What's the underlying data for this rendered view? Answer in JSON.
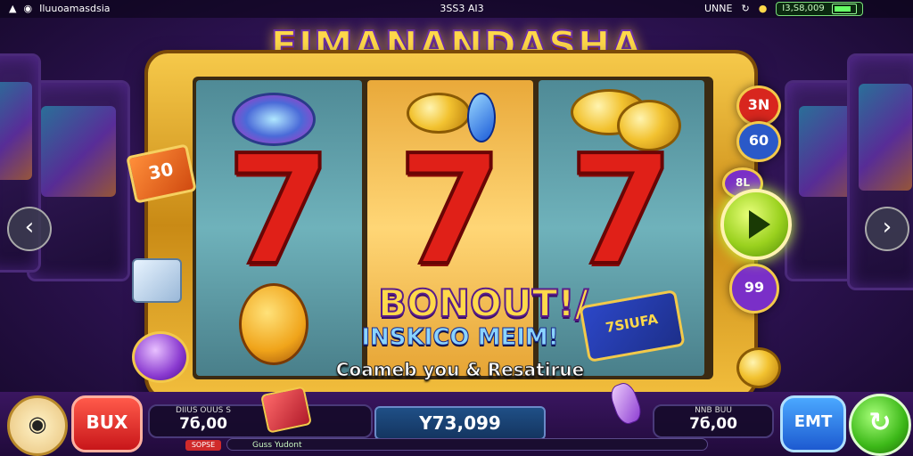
{
  "status_bar": {
    "app_name": "Iluuoamasdsia",
    "time": "3SS3 AI3",
    "right_label": "UNNE",
    "balance_text": "I3,S8,009"
  },
  "game": {
    "title": "EIMANANDASHA",
    "reels": [
      {
        "symbol": "7"
      },
      {
        "symbol": "7"
      },
      {
        "symbol": "7"
      }
    ],
    "bonus": {
      "headline": "BONOUT!/",
      "subline": "INSKICO MEIM!",
      "caption": "Coameb you & Resatirue",
      "ticket": "7SIUFA"
    },
    "left_badge": "30",
    "side_chips": [
      "3N",
      "60",
      "8L",
      "99"
    ]
  },
  "bottom_bar": {
    "menu_icon": "joystick-icon",
    "buy_label": "BUX",
    "left_panel": {
      "label": "DIIUS OUUS S",
      "value": "7б,00"
    },
    "win_value": "Y73,099",
    "right_panel": {
      "label": "NNB BUU",
      "value": "7б,00"
    },
    "bet_label": "EMT",
    "spin_icon": "refresh-icon",
    "tag": "SOPSE",
    "message": "Guss Yudont"
  },
  "colors": {
    "accent_gold": "#f6c94a",
    "seven_red": "#e02018",
    "spin_green": "#3cb818",
    "bet_blue": "#1d5ad0",
    "buy_red": "#c8161a"
  }
}
